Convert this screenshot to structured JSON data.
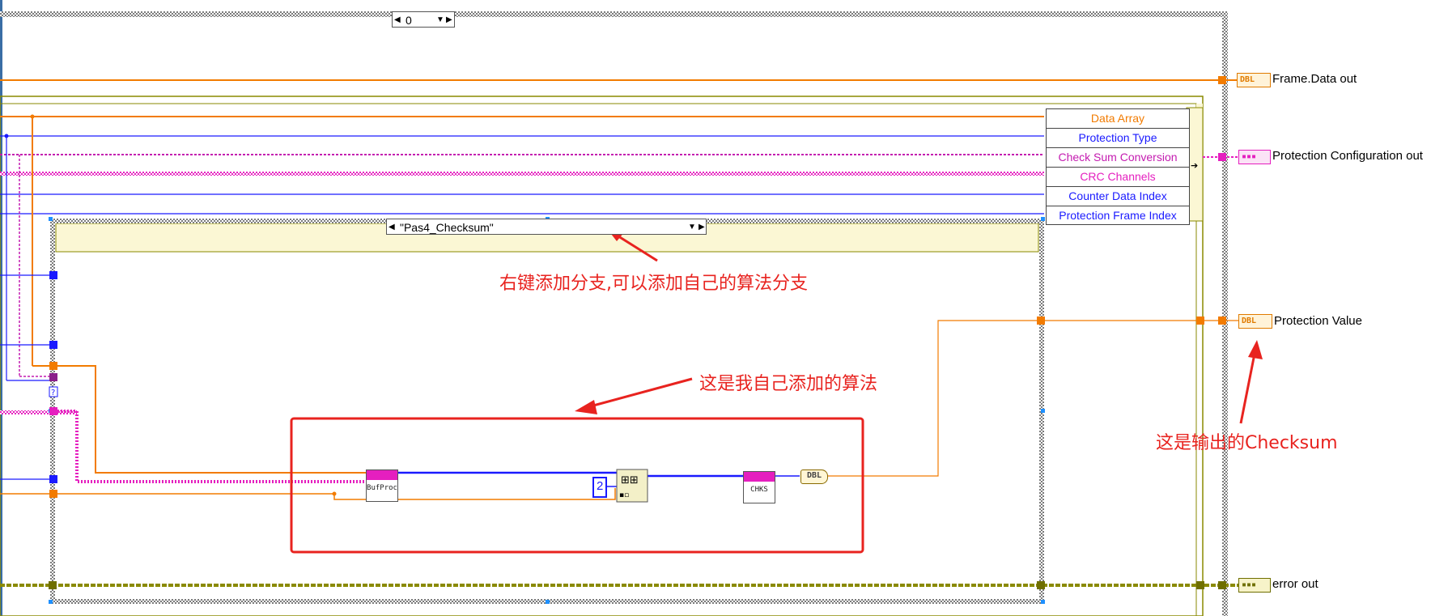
{
  "case_structures": {
    "outer_selector_value": "0",
    "inner_selector_value": "\"Pas4_Checksum\""
  },
  "unbundle_by_name": {
    "items": [
      {
        "label": "Data Array",
        "color": "#f27b00"
      },
      {
        "label": "Protection Type",
        "color": "#1a1aff"
      },
      {
        "label": "Check Sum Conversion",
        "color": "#c41bb0"
      },
      {
        "label": "CRC Channels",
        "color": "#e51fbf"
      },
      {
        "label": "Counter Data Index",
        "color": "#1a1aff"
      },
      {
        "label": "Protection Frame Index",
        "color": "#1a1aff"
      }
    ]
  },
  "outputs": {
    "frame_data_out": "Frame.Data out",
    "protection_configuration_out": "Protection Configuration out",
    "protection_value": "Protection Value",
    "error_out": "error out"
  },
  "terminal_types": {
    "dbl": "DBL",
    "cluster": "▪▪▪"
  },
  "nodes": {
    "bufproc": "BufProc",
    "chks": "CHKS",
    "constant_value": "2",
    "dbl_conversion": "DBL"
  },
  "annotations": {
    "right_click_hint": "右键添加分支,可以添加自己的算法分支",
    "my_algorithm": "这是我自己添加的算法",
    "output_checksum": "这是输出的Checksum"
  },
  "colors": {
    "orange_wire": "#f27b00",
    "blue_wire": "#1a1aff",
    "pink_wire": "#e51fbf",
    "error_wire": "#8a8a00",
    "annotation_red": "#e8231f",
    "case_header": "#fbf7d4"
  }
}
